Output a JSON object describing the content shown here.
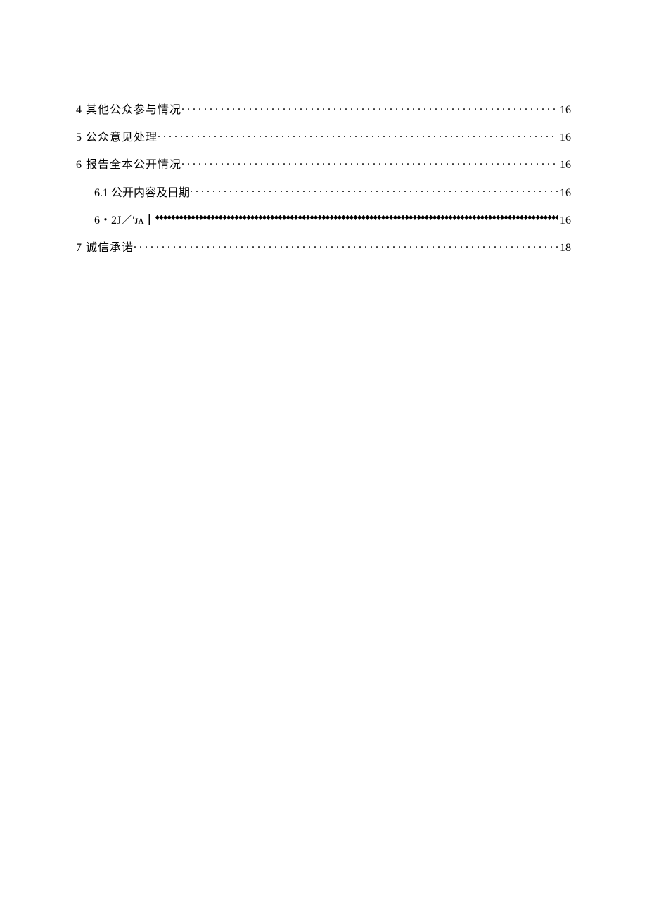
{
  "toc": {
    "entries": [
      {
        "label": "4 其他公众参与情况",
        "page": "16",
        "level": 1,
        "leader": "dot"
      },
      {
        "label": "5 公众意见处理",
        "page": "16",
        "level": 1,
        "leader": "dot"
      },
      {
        "label": "6 报告全本公开情况",
        "page": "16",
        "level": 1,
        "leader": "dot"
      },
      {
        "label": "6.1 公开内容及日期",
        "page": "16",
        "level": 2,
        "leader": "dot"
      },
      {
        "label": "6・2J／′ᴊᴀ┃",
        "page": "16",
        "level": 2,
        "leader": "diamond"
      },
      {
        "label": "7 诚信承诺",
        "page": "18",
        "level": 1,
        "leader": "dot"
      }
    ]
  }
}
